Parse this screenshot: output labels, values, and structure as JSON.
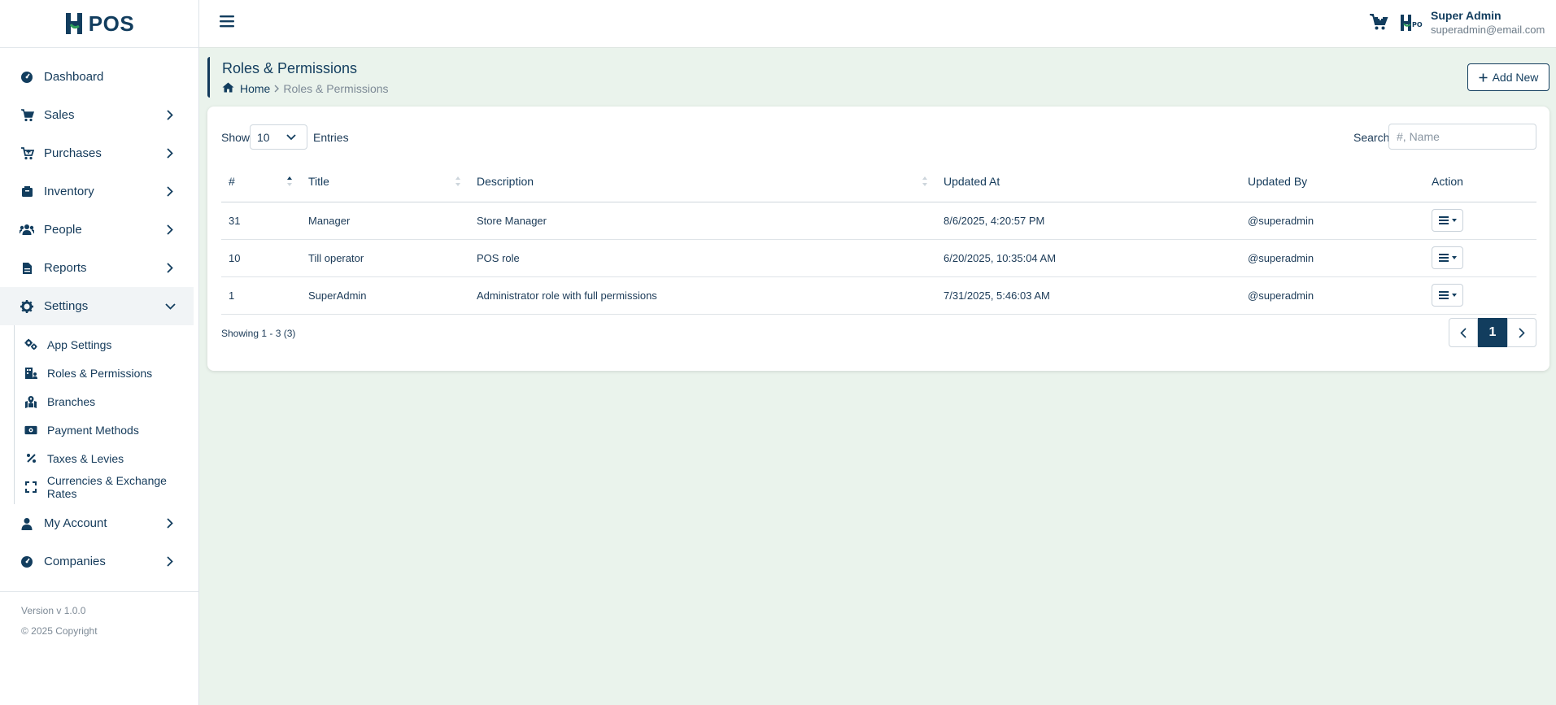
{
  "brand": {
    "logo_text": "POS"
  },
  "sidebar": {
    "items": [
      {
        "label": "Dashboard",
        "icon": "dashboard-icon",
        "has_chevron": false
      },
      {
        "label": "Sales",
        "icon": "cart-icon",
        "has_chevron": true
      },
      {
        "label": "Purchases",
        "icon": "cart-plus-icon",
        "has_chevron": true
      },
      {
        "label": "Inventory",
        "icon": "box-icon",
        "has_chevron": true
      },
      {
        "label": "People",
        "icon": "users-icon",
        "has_chevron": true
      },
      {
        "label": "Reports",
        "icon": "file-icon",
        "has_chevron": true
      },
      {
        "label": "Settings",
        "icon": "gear-icon",
        "expanded": true
      },
      {
        "label": "My Account",
        "icon": "user-icon",
        "has_chevron": true
      },
      {
        "label": "Companies",
        "icon": "dashboard-icon",
        "has_chevron": true
      }
    ],
    "settings_sub": [
      {
        "label": "App Settings",
        "icon": "gears-icon"
      },
      {
        "label": "Roles & Permissions",
        "icon": "building-user-icon"
      },
      {
        "label": "Branches",
        "icon": "map-location-icon"
      },
      {
        "label": "Payment Methods",
        "icon": "money-bill-icon"
      },
      {
        "label": "Taxes & Levies",
        "icon": "percent-icon"
      },
      {
        "label": "Currencies & Exchange Rates",
        "icon": "expand-icon"
      }
    ],
    "footer": {
      "version": "Version v 1.0.0",
      "copyright": "© 2025 Copyright"
    }
  },
  "topbar": {
    "user_name": "Super Admin",
    "user_email": "superadmin@email.com"
  },
  "page": {
    "title": "Roles & Permissions",
    "breadcrumb_home": "Home",
    "breadcrumb_current": "Roles & Permissions",
    "add_button": "Add New"
  },
  "table_controls": {
    "show_label": "Show",
    "entries_value": "10",
    "entries_label": "Entries",
    "search_label": "Search",
    "search_placeholder": "#, Name"
  },
  "table": {
    "columns": [
      "#",
      "Title",
      "Description",
      "Updated At",
      "Updated By",
      "Action"
    ],
    "rows": [
      {
        "id": "31",
        "title": "Manager",
        "description": "Store Manager",
        "updated_at": "8/6/2025, 4:20:57 PM",
        "updated_by": "@superadmin"
      },
      {
        "id": "10",
        "title": "Till operator",
        "description": "POS role",
        "updated_at": "6/20/2025, 10:35:04 AM",
        "updated_by": "@superadmin"
      },
      {
        "id": "1",
        "title": "SuperAdmin",
        "description": "Administrator role with full permissions",
        "updated_at": "7/31/2025, 5:46:03 AM",
        "updated_by": "@superadmin"
      }
    ]
  },
  "pagination": {
    "showing": "Showing 1 - 3 (3)",
    "current_page": "1"
  },
  "colors": {
    "primary": "#123d5e",
    "background": "#eaf3ec",
    "accent_green": "#2e9e5b"
  }
}
